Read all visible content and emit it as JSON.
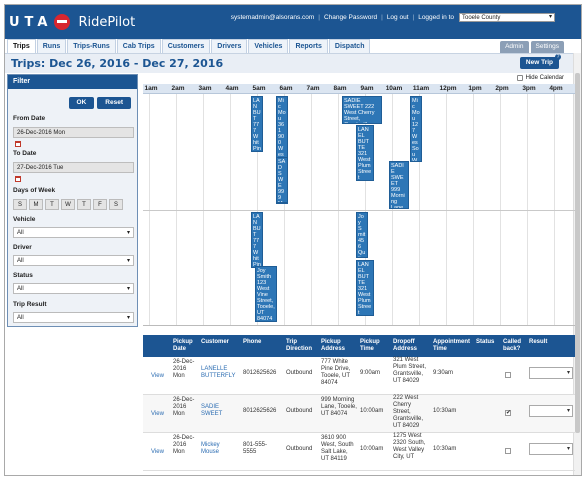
{
  "header": {
    "logo_text": "UTA",
    "app_name": "RidePilot",
    "user_email": "systemadmin@alsorans.com",
    "change_password": "Change Password",
    "logout": "Log out",
    "logged_in_to": "Logged in to",
    "county": "Tooele County"
  },
  "nav": {
    "tabs": [
      "Trips",
      "Runs",
      "Trips-Runs",
      "Cab Trips",
      "Customers",
      "Drivers",
      "Vehicles",
      "Reports",
      "Dispatch"
    ],
    "admin_tabs": [
      "Admin",
      "Settings"
    ]
  },
  "page": {
    "title": "Trips: Dec 26, 2016 - Dec 27, 2016",
    "help": "?",
    "new_trip": "New Trip",
    "hide_calendar": "Hide Calendar"
  },
  "filter": {
    "title": "Filter",
    "ok": "OK",
    "reset": "Reset",
    "from_label": "From Date",
    "from_value": "26-Dec-2016 Mon",
    "to_label": "To Date",
    "to_value": "27-Dec-2016 Tue",
    "days_label": "Days of Week",
    "days": [
      "S",
      "M",
      "T",
      "W",
      "T",
      "F",
      "S"
    ],
    "vehicle_label": "Vehicle",
    "vehicle_value": "All",
    "driver_label": "Driver",
    "driver_value": "All",
    "status_label": "Status",
    "status_value": "All",
    "result_label": "Trip Result",
    "result_value": "All"
  },
  "calendar": {
    "hours": [
      "1am",
      "2am",
      "3am",
      "4am",
      "5am",
      "6am",
      "7am",
      "8am",
      "9am",
      "10am",
      "11am",
      "12pm",
      "1pm",
      "2pm",
      "3pm",
      "4pm"
    ],
    "events": [
      {
        "text": "LAN BUT 777 Whit Pine Drive Tooele UT 840"
      },
      {
        "text": "Mic Mou 361 900 Wes Sou Salt Lake UT 841"
      },
      {
        "text": "SADIE SWEET 222 West Cherry Street, Grantsville, UT 84029"
      },
      {
        "text": "Mic Mou 127 Wes Sou Wes Vall City UT 841"
      },
      {
        "text": "LANEL BUTTE 321 West Plum Street Grants UT 84029"
      },
      {
        "text": "SAD SWE 999 Mor Lan Tooe UT 840"
      },
      {
        "text": "SADIE SWEET 999 Morning Lane, Tooele, UT 84074"
      },
      {
        "text": "LAN BUT 777 Whit Pine Drive Tooe UT 840"
      },
      {
        "text": "Joy Smith 123 West Vine Street, Tooele, UT 84074"
      },
      {
        "text": "Joy Smit 456 Quit Stre Gran UT 840"
      },
      {
        "text": "LANEL BUTTE 321 West Plum Street Grants UT 84029"
      }
    ]
  },
  "table": {
    "headers": [
      "",
      "Pickup Date",
      "Customer",
      "Phone",
      "Trip Direction",
      "Pickup Address",
      "Pickup Time",
      "Dropoff Address",
      "Appointment Time",
      "Status",
      "Called back?",
      "Result"
    ],
    "rows": [
      {
        "view": "View",
        "date": "26-Dec-2016 Mon",
        "customer": "LANELLE BUTTERFLY",
        "phone": "8012625626",
        "direction": "Outbound",
        "pickup": "777 White Pine Drive, Tooele, UT 84074",
        "pickup_time": "9:00am",
        "dropoff": "321 West Plum Street, Grantsville, UT 84029",
        "appt": "9:30am",
        "called": false
      },
      {
        "view": "View",
        "date": "26-Dec-2016 Mon",
        "customer": "SADIE SWEET",
        "phone": "8012625626",
        "direction": "Outbound",
        "pickup": "999 Morning Lane, Tooele, UT 84074",
        "pickup_time": "10:00am",
        "dropoff": "222 West Cherry Street, Grantsville, UT 84029",
        "appt": "10:30am",
        "called": true
      },
      {
        "view": "View",
        "date": "26-Dec-2016 Mon",
        "customer": "Mickey Mouse",
        "phone": "801-555-5555",
        "direction": "Outbound",
        "pickup": "3610 900 West, South Salt Lake, UT 84119",
        "pickup_time": "10:00am",
        "dropoff": "1275 West 2320 South, West Valley City, UT",
        "appt": "10:30am",
        "called": false
      }
    ]
  },
  "colors": {
    "brand": "#1c5592",
    "accent_red": "#d8262f",
    "event": "#2d76b6"
  }
}
